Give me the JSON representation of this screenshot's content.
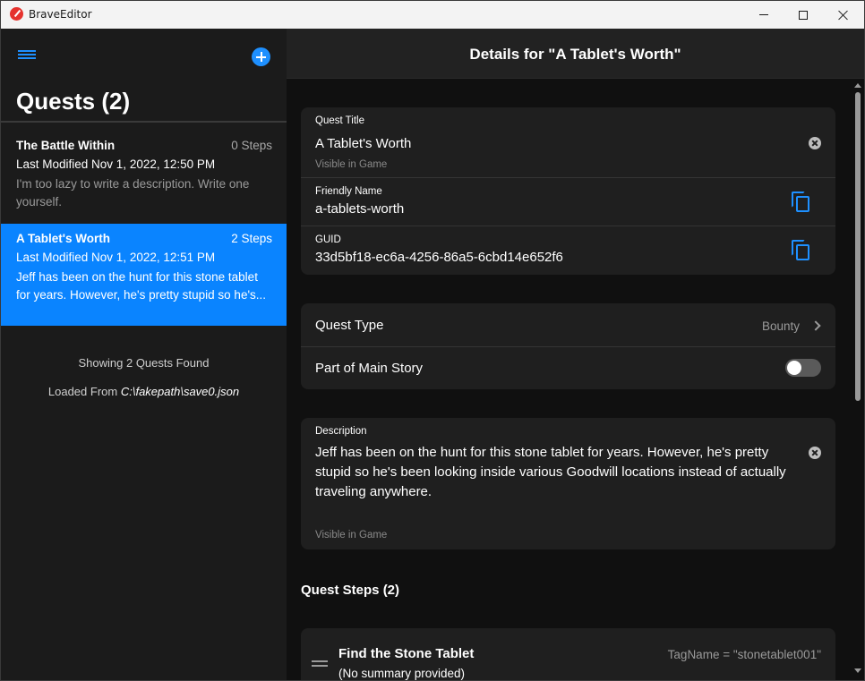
{
  "window": {
    "title": "BraveEditor"
  },
  "sidebar": {
    "title": "Quests (2)",
    "quests": [
      {
        "name": "The Battle Within",
        "steps": "0 Steps",
        "modified": "Last Modified Nov 1, 2022, 12:50 PM",
        "desc_line1": "I'm too lazy to write a description. Write one",
        "desc_line2": "yourself."
      },
      {
        "name": "A Tablet's Worth",
        "steps": "2 Steps",
        "modified": "Last Modified Nov 1, 2022, 12:51 PM",
        "desc_line1": "Jeff has been on the hunt for this stone tablet",
        "desc_line2": "for years. However, he's pretty stupid so he's...",
        "selected": true
      }
    ],
    "status": "Showing 2 Quests Found",
    "loaded_prefix": "Loaded From",
    "loaded_path": "C:\\fakepath\\save0.json"
  },
  "main": {
    "header": "Details for \"A Tablet's Worth\"",
    "quest_title": {
      "label": "Quest Title",
      "value": "A Tablet's Worth",
      "hint": "Visible in Game"
    },
    "friendly_name": {
      "label": "Friendly Name",
      "value": "a-tablets-worth"
    },
    "guid": {
      "label": "GUID",
      "value": "33d5bf18-ec6a-4256-86a5-6cbd14e652f6"
    },
    "quest_type": {
      "label": "Quest Type",
      "value": "Bounty"
    },
    "main_story": {
      "label": "Part of Main Story",
      "on": false
    },
    "description": {
      "label": "Description",
      "line1": "Jeff has been on the hunt for this stone tablet for years. However, he's pretty",
      "line2": "stupid so he's been looking inside various Goodwill locations instead of actually",
      "line3": "traveling anywhere.",
      "hint": "Visible in Game"
    },
    "steps_section": "Quest Steps (2)",
    "steps": [
      {
        "name": "Find the Stone Tablet",
        "summary": "(No summary provided)",
        "tag": "TagName = \"stonetablet001\""
      }
    ]
  },
  "colors": {
    "accent": "#0a84ff",
    "sidebar_bg": "#1b1b1b",
    "card_bg": "#1f1f1f"
  }
}
